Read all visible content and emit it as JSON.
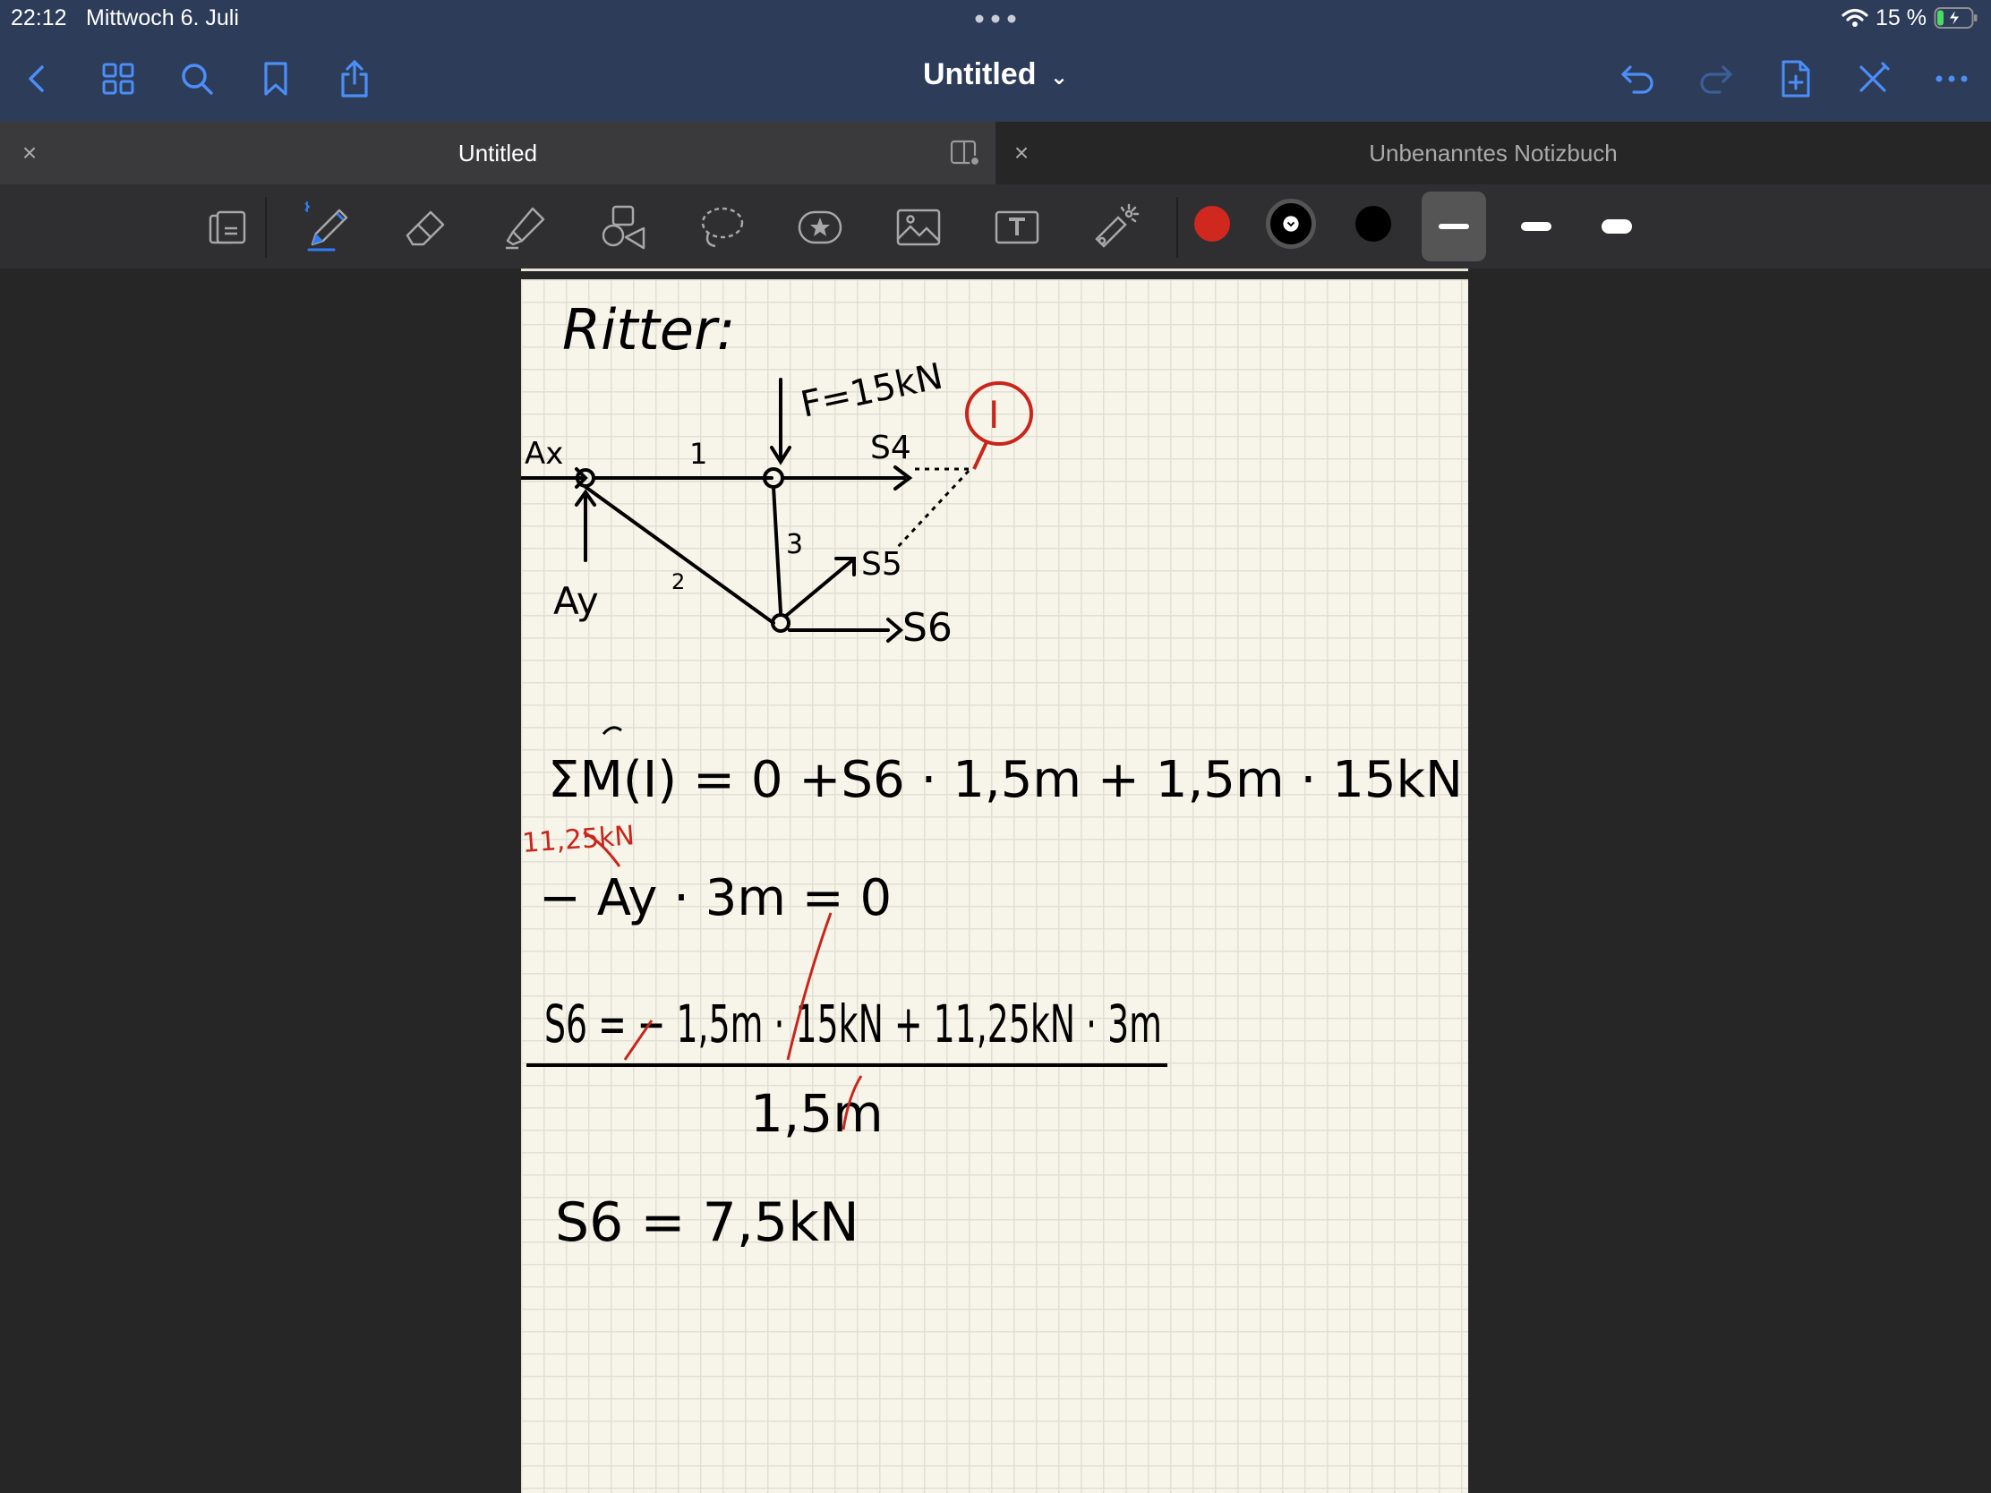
{
  "status": {
    "time": "22:12",
    "date": "Mittwoch 6. Juli",
    "battery": "15 %"
  },
  "nav": {
    "title": "Untitled",
    "icons": [
      "back-icon",
      "grid-icon",
      "search-icon",
      "bookmark-icon",
      "share-icon",
      "undo-icon",
      "redo-icon",
      "add-page-icon",
      "close-pen-icon",
      "more-icon"
    ]
  },
  "tabs": [
    {
      "label": "Untitled",
      "active": true
    },
    {
      "label": "Unbenanntes Notizbuch",
      "active": false
    }
  ],
  "toolbar": {
    "colors": [
      "#d0281e",
      "#000000",
      "#000000"
    ],
    "accent": "#2f7df6"
  },
  "note": {
    "title": "Ritter:",
    "force_label": "F=15kN",
    "cut_label": "I",
    "ax_label": "Ax",
    "ay_label": "Ay",
    "member_1": "1",
    "member_2": "2",
    "member_3": "3",
    "s4": "S4",
    "s5": "S5",
    "s6": "S6",
    "eq1": "ΣM(I) = 0   +S6 · 1,5m + 1,5m · 15kN",
    "eq1_annot": "11,25kN",
    "eq2": "− Ay · 3m = 0",
    "eq3_num": "S6 = − 1,5m · 15kN + 11,25kN · 3m",
    "eq3_den": "1,5m",
    "result": "S6 = 7,5kN"
  }
}
